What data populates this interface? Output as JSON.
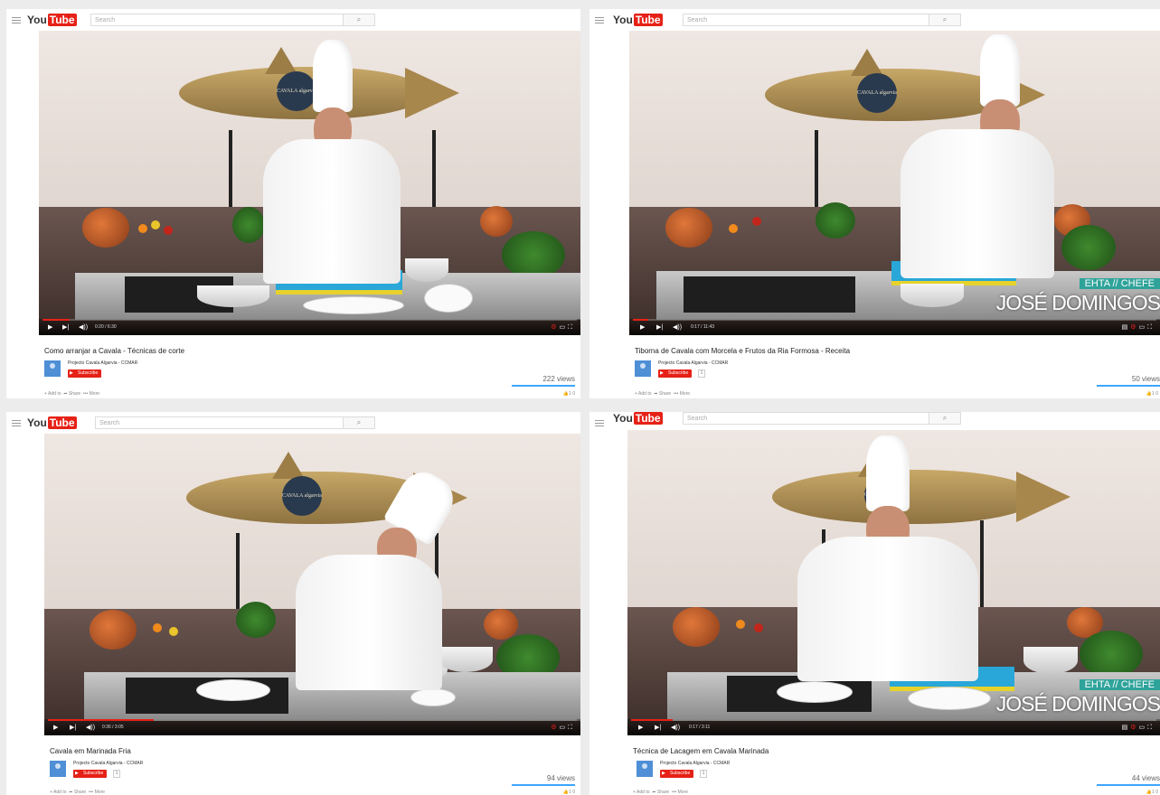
{
  "brand": {
    "you": "You",
    "tube": "Tube"
  },
  "search_placeholder": "Search",
  "actions": {
    "add": "+ Add to",
    "share": "Share",
    "more": "••• More"
  },
  "panels": [
    {
      "title": "Como arranjar a Cavala - Técnicas de corte",
      "channel": "Projecto Cavala Algarvia - CCMAR",
      "subscribe": "Subscribe",
      "subcount": "",
      "views": "222 views",
      "time": "0:20 / 6:30",
      "progress": 0.05,
      "likes": "1  0",
      "overlay": null
    },
    {
      "title": "Tiborna de Cavala com Morcela e Frutos da Ria Formosa - Receita",
      "channel": "Projecto Cavala Algarvia - CCMAR",
      "subscribe": "Subscribe",
      "subcount": "1",
      "views": "50 views",
      "time": "0:17 / 11:43",
      "progress": 0.03,
      "likes": "1  0",
      "overlay": {
        "tag": "EHTA // CHEFE",
        "name": "JOSÉ DOMINGOS"
      }
    },
    {
      "title": "Cavala em Marinada Fria",
      "channel": "Projecto Cavala Algarvia - CCMAR",
      "subscribe": "Subscribe",
      "subcount": "1",
      "views": "94 views",
      "time": "0:36 / 3:05",
      "progress": 0.2,
      "likes": "1  0",
      "overlay": null
    },
    {
      "title": "Técnica de Lacagem em Cavala Marinada",
      "channel": "Projecto Cavala Algarvia - CCMAR",
      "subscribe": "Subscribe",
      "subcount": "1",
      "views": "44 views",
      "time": "0:17 / 3:11",
      "progress": 0.08,
      "likes": "1  0",
      "overlay": {
        "tag": "EHTA // CHEFE",
        "name": "JOSÉ DOMINGOS"
      }
    }
  ],
  "fish_logo_text": "CAVALA algarvia",
  "colors": {
    "youtube_red": "#e62117",
    "overlay_teal": "#2ea39a",
    "view_bar": "#3ea6ff"
  }
}
